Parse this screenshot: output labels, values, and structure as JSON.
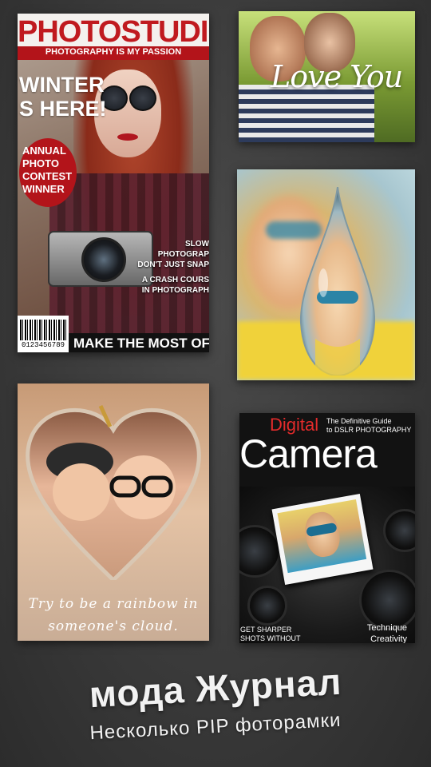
{
  "colors": {
    "background": "#3a3a3a",
    "magazine_red": "#b3141a",
    "digital_red": "#e32b2b"
  },
  "frames": {
    "photostudio": {
      "title": "PHOTOSTUDIO",
      "tagline": "PHOTOGRAPHY IS MY PASSION",
      "headline_line1": "WINTER",
      "headline_line2": "S HERE!",
      "badge_line1": "ANNUAL",
      "badge_line2": "PHOTO",
      "badge_line3": "CONTEST",
      "badge_line4": "WINNER",
      "side_line1": "SLOW PHOTOGRAP",
      "side_line2": "DON'T JUST SNAP",
      "side_line3": "A CRASH COURS",
      "side_line4": "IN PHOTOGRAPH",
      "barcode_number": "0123456789",
      "bottom_banner": "MAKE THE MOST OF"
    },
    "love": {
      "caption": "Love You"
    },
    "drop": {
      "icon": "water-drop"
    },
    "heart": {
      "quote_line1": "Try to be a rainbow in",
      "quote_line2": "someone's cloud."
    },
    "digital_camera": {
      "digital": "Digital",
      "guide_line1": "The Definitive Guide",
      "guide_line2": "to DSLR PHOTOGRAPHY",
      "camera": "Camera",
      "sharper_line1": "GET SHARPER",
      "sharper_line2": "SHOTS WITHOUT",
      "technique": "Technique",
      "creativity": "Creativity"
    }
  },
  "footer": {
    "title": "мода Журнал",
    "subtitle": "Несколько PIP фоторамки"
  }
}
